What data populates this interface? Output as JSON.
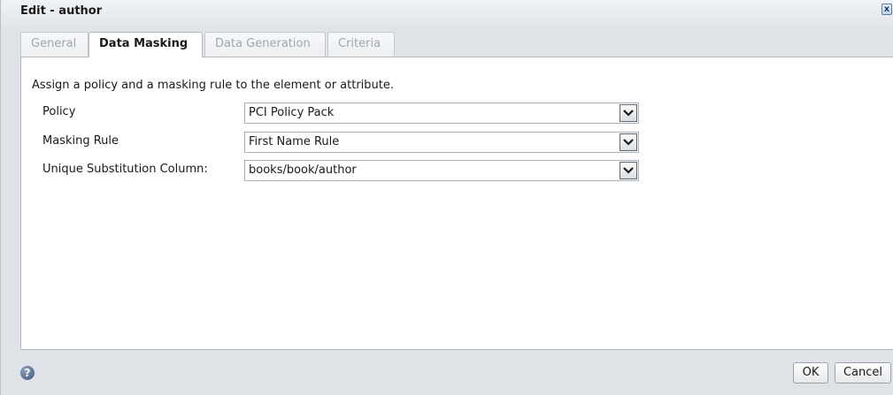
{
  "window": {
    "title": "Edit - author",
    "close_symbol": "x"
  },
  "tabs": [
    {
      "label": "General",
      "active": false
    },
    {
      "label": "Data Masking",
      "active": true
    },
    {
      "label": "Data Generation",
      "active": false
    },
    {
      "label": "Criteria",
      "active": false
    }
  ],
  "panel": {
    "instruction": "Assign a policy and a masking rule to the element or attribute.",
    "fields": [
      {
        "label": "Policy",
        "value": "PCI Policy Pack"
      },
      {
        "label": "Masking Rule",
        "value": "First Name Rule"
      },
      {
        "label": "Unique Substitution Column:",
        "value": "books/book/author"
      }
    ]
  },
  "footer": {
    "help_symbol": "?",
    "ok_label": "OK",
    "cancel_label": "Cancel"
  },
  "icons": {
    "close": "close-icon",
    "help": "help-icon",
    "dropdown": "chevron-down-icon"
  }
}
